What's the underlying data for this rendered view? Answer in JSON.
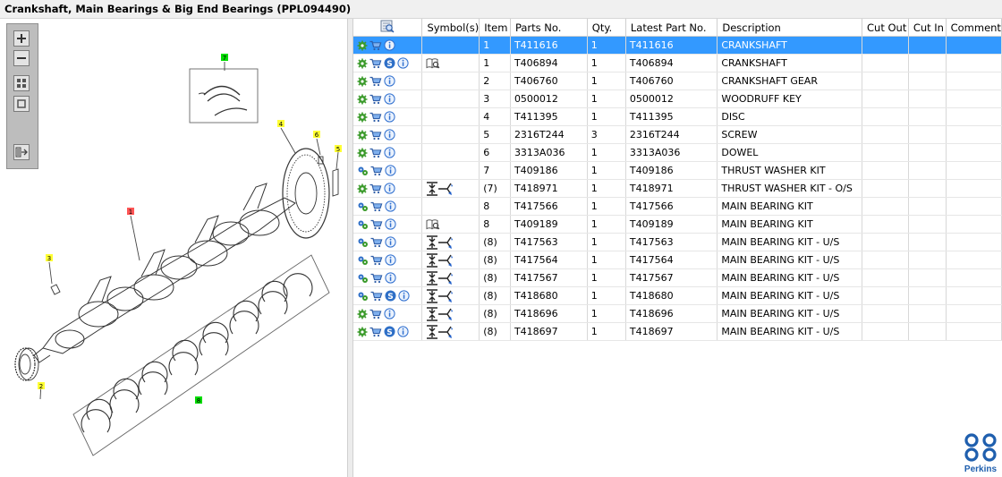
{
  "window": {
    "title": "Crankshaft, Main Bearings & Big End Bearings (PPL094490)"
  },
  "toolbar": {
    "tools": [
      "zoom-in-icon",
      "zoom-out-icon",
      "fit-all-icon",
      "fit-page-icon",
      "export-icon"
    ]
  },
  "diagram": {
    "callouts": [
      {
        "label": "7",
        "color": "#00dd00"
      },
      {
        "label": "4",
        "color": "#ffff33"
      },
      {
        "label": "6",
        "color": "#ffff33"
      },
      {
        "label": "5",
        "color": "#ffff33"
      },
      {
        "label": "1",
        "color": "#ff5555"
      },
      {
        "label": "3",
        "color": "#ffff33"
      },
      {
        "label": "2",
        "color": "#ffff33"
      },
      {
        "label": "8",
        "color": "#00dd00"
      }
    ]
  },
  "grid": {
    "columns": [
      "",
      "Symbol(s)",
      "Item",
      "Parts No.",
      "Qty.",
      "Latest Part No.",
      "Description",
      "Cut Out",
      "Cut In",
      "Comment"
    ],
    "rows": [
      {
        "icons": [
          "gear-icon",
          "cart-icon",
          "info-icon"
        ],
        "symbol": "",
        "item": "1",
        "part": "T411616",
        "qty": "1",
        "latest": "T411616",
        "desc": "CRANKSHAFT",
        "selected": true
      },
      {
        "icons": [
          "gear-icon",
          "cart-icon",
          "s-badge-icon",
          "info-icon"
        ],
        "symbol": "book-icon",
        "item": "1",
        "part": "T406894",
        "qty": "1",
        "latest": "T406894",
        "desc": "CRANKSHAFT"
      },
      {
        "icons": [
          "gear-icon",
          "cart-icon",
          "info-icon"
        ],
        "symbol": "",
        "item": "2",
        "part": "T406760",
        "qty": "1",
        "latest": "T406760",
        "desc": "CRANKSHAFT GEAR"
      },
      {
        "icons": [
          "gear-icon",
          "cart-icon",
          "info-icon"
        ],
        "symbol": "",
        "item": "3",
        "part": "0500012",
        "qty": "1",
        "latest": "0500012",
        "desc": "WOODRUFF KEY"
      },
      {
        "icons": [
          "gear-icon",
          "cart-icon",
          "info-icon"
        ],
        "symbol": "",
        "item": "4",
        "part": "T411395",
        "qty": "1",
        "latest": "T411395",
        "desc": "DISC"
      },
      {
        "icons": [
          "gear-icon",
          "cart-icon",
          "info-icon"
        ],
        "symbol": "",
        "item": "5",
        "part": "2316T244",
        "qty": "3",
        "latest": "2316T244",
        "desc": "SCREW"
      },
      {
        "icons": [
          "gear-icon",
          "cart-icon",
          "info-icon"
        ],
        "symbol": "",
        "item": "6",
        "part": "3313A036",
        "qty": "1",
        "latest": "3313A036",
        "desc": "DOWEL"
      },
      {
        "icons": [
          "gears-icon",
          "cart-icon",
          "info-icon"
        ],
        "symbol": "",
        "item": "7",
        "part": "T409186",
        "qty": "1",
        "latest": "T409186",
        "desc": "THRUST WASHER KIT"
      },
      {
        "icons": [
          "gear-icon",
          "cart-icon",
          "info-icon"
        ],
        "symbol": "interchange-icon",
        "item": "(7)",
        "part": "T418971",
        "qty": "1",
        "latest": "T418971",
        "desc": "THRUST WASHER KIT - O/S"
      },
      {
        "icons": [
          "gears-icon",
          "cart-icon",
          "info-icon"
        ],
        "symbol": "",
        "item": "8",
        "part": "T417566",
        "qty": "1",
        "latest": "T417566",
        "desc": "MAIN BEARING KIT"
      },
      {
        "icons": [
          "gears-icon",
          "cart-icon",
          "info-icon"
        ],
        "symbol": "book-icon",
        "item": "8",
        "part": "T409189",
        "qty": "1",
        "latest": "T409189",
        "desc": "MAIN BEARING KIT"
      },
      {
        "icons": [
          "gears-icon",
          "cart-icon",
          "info-icon"
        ],
        "symbol": "interchange-icon",
        "item": "(8)",
        "part": "T417563",
        "qty": "1",
        "latest": "T417563",
        "desc": "MAIN BEARING KIT - U/S"
      },
      {
        "icons": [
          "gears-icon",
          "cart-icon",
          "info-icon"
        ],
        "symbol": "interchange-icon",
        "item": "(8)",
        "part": "T417564",
        "qty": "1",
        "latest": "T417564",
        "desc": "MAIN BEARING KIT - U/S"
      },
      {
        "icons": [
          "gears-icon",
          "cart-icon",
          "info-icon"
        ],
        "symbol": "interchange-icon",
        "item": "(8)",
        "part": "T417567",
        "qty": "1",
        "latest": "T417567",
        "desc": "MAIN BEARING KIT - U/S"
      },
      {
        "icons": [
          "gears-icon",
          "cart-icon",
          "s-badge-icon",
          "info-icon"
        ],
        "symbol": "interchange-icon",
        "item": "(8)",
        "part": "T418680",
        "qty": "1",
        "latest": "T418680",
        "desc": "MAIN BEARING KIT - U/S"
      },
      {
        "icons": [
          "gear-icon",
          "cart-icon",
          "info-icon"
        ],
        "symbol": "interchange-icon",
        "item": "(8)",
        "part": "T418696",
        "qty": "1",
        "latest": "T418696",
        "desc": "MAIN BEARING KIT - U/S"
      },
      {
        "icons": [
          "gear-icon",
          "cart-icon",
          "s-badge-icon",
          "info-icon"
        ],
        "symbol": "interchange-icon",
        "item": "(8)",
        "part": "T418697",
        "qty": "1",
        "latest": "T418697",
        "desc": "MAIN BEARING KIT - U/S"
      }
    ]
  },
  "brand": {
    "name": "Perkins",
    "color": "#1f5fae"
  }
}
